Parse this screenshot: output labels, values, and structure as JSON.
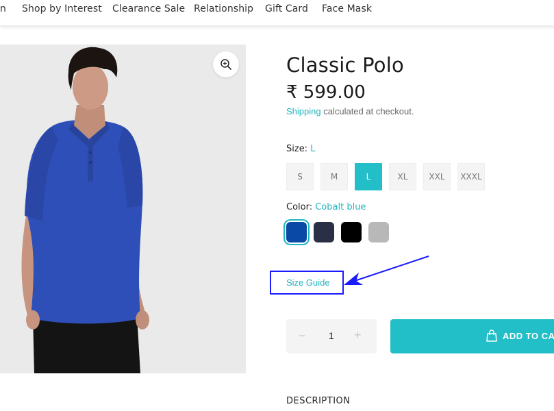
{
  "nav": {
    "items": [
      "n",
      "Shop by Interest",
      "Clearance Sale",
      "Relationship",
      "Gift Card",
      "Face Mask"
    ]
  },
  "product": {
    "title": "Classic Polo",
    "price": "₹ 599.00",
    "shipping_link": "Shipping",
    "shipping_rest": " calculated at checkout.",
    "image_shirt_color": "#2f4fb8"
  },
  "size": {
    "label": "Size:",
    "selected": "L",
    "options": [
      "S",
      "M",
      "L",
      "XL",
      "XXL",
      "XXXL"
    ]
  },
  "color": {
    "label": "Color:",
    "selected": "Cobalt blue",
    "swatches": [
      "#0a4aa6",
      "#2a2f45",
      "#000000",
      "#b8b8b8"
    ]
  },
  "size_guide": {
    "label": "Size Guide"
  },
  "quantity": {
    "minus": "−",
    "value": "1",
    "plus": "+"
  },
  "cart": {
    "label": "ADD TO CART"
  },
  "description": {
    "heading": "DESCRIPTION"
  },
  "colors": {
    "accent": "#22bfc8",
    "annotation": "#1a1aff"
  }
}
